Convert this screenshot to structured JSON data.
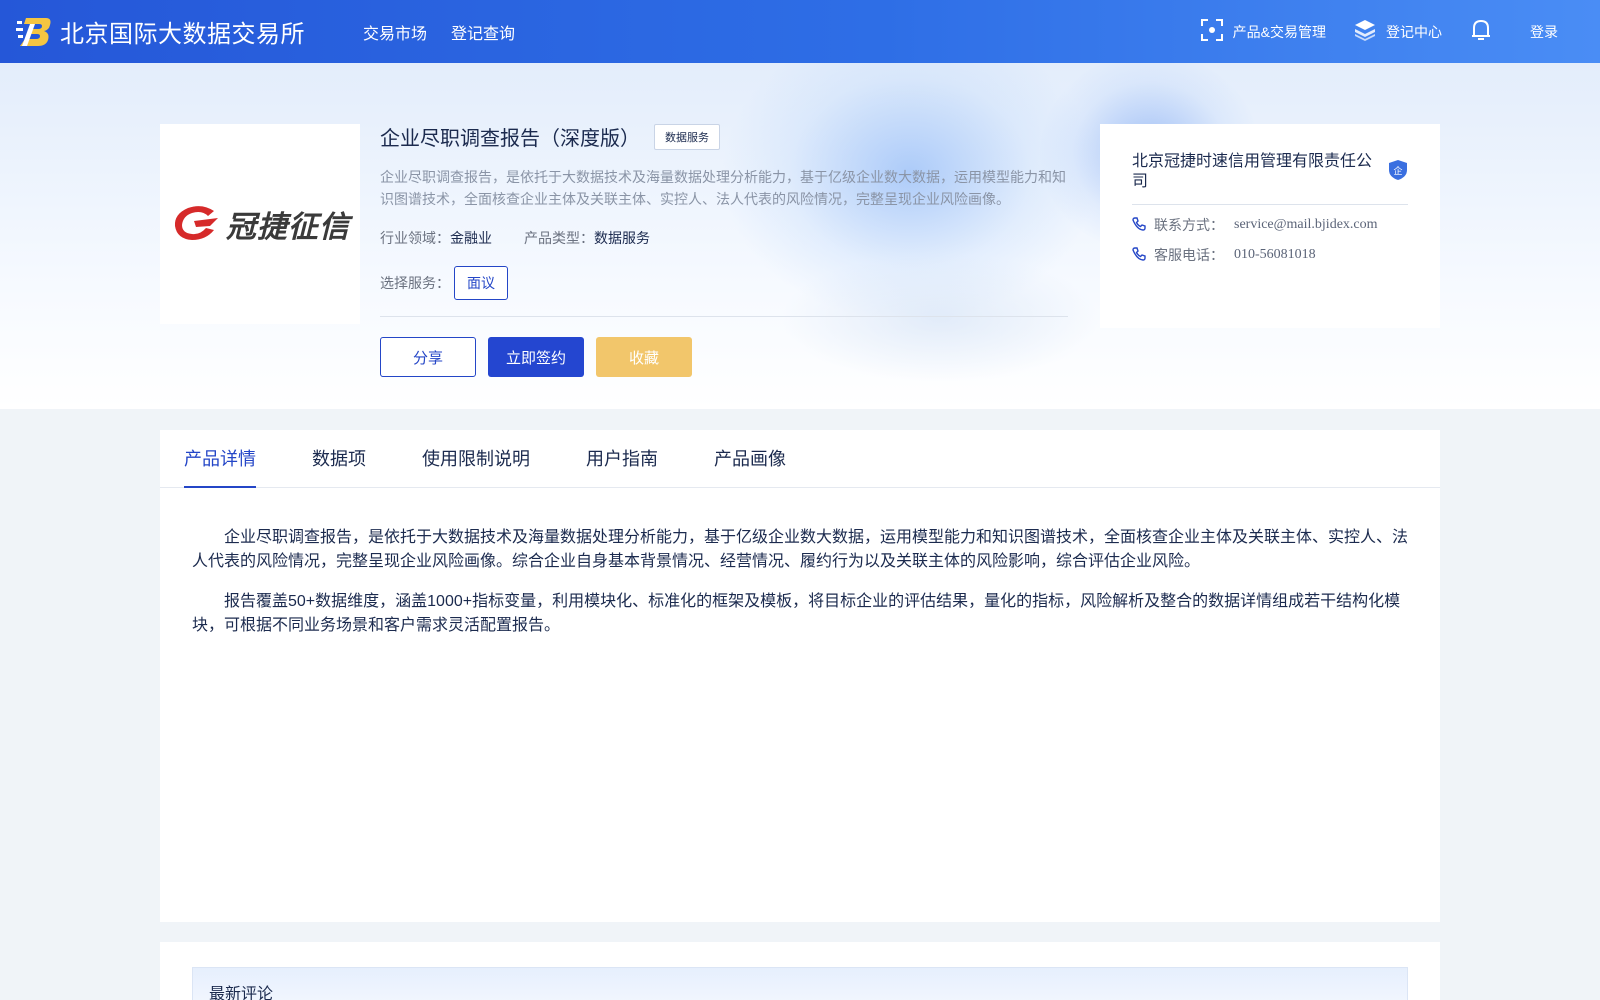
{
  "header": {
    "title": "北京国际大数据交易所",
    "nav": [
      "交易市场",
      "登记查询"
    ],
    "right": {
      "product_mgmt": "产品&交易管理",
      "register_center": "登记中心",
      "login": "登录"
    }
  },
  "product": {
    "logo_text": "冠捷征信",
    "title": "企业尽职调查报告（深度版）",
    "tag": "数据服务",
    "description": "企业尽职调查报告，是依托于大数据技术及海量数据处理分析能力，基于亿级企业数大数据，运用模型能力和知识图谱技术，全面核查企业主体及关联主体、实控人、法人代表的风险情况，完整呈现企业风险画像。",
    "industry_label": "行业领域：",
    "industry": "金融业",
    "type_label": "产品类型：",
    "type": "数据服务",
    "service_label": "选择服务：",
    "service_option": "面议",
    "actions": {
      "share": "分享",
      "sign": "立即签约",
      "favorite": "收藏"
    }
  },
  "company": {
    "name": "北京冠捷时速信用管理有限责任公司",
    "badge": "企",
    "contact_label": "联系方式：",
    "contact": "service@mail.bjidex.com",
    "phone_label": "客服电话：",
    "phone": "010-56081018"
  },
  "tabs": [
    "产品详情",
    "数据项",
    "使用限制说明",
    "用户指南",
    "产品画像"
  ],
  "active_tab": 0,
  "detail": {
    "paragraphs": [
      "企业尽职调查报告，是依托于大数据技术及海量数据处理分析能力，基于亿级企业数大数据，运用模型能力和知识图谱技术，全面核查企业主体及关联主体、实控人、法人代表的风险情况，完整呈现企业风险画像。综合企业自身基本背景情况、经营情况、履约行为以及关联主体的风险影响，综合评估企业风险。",
      "报告覆盖50+数据维度，涵盖1000+指标变量，利用模块化、标准化的框架及模板，将目标企业的评估结果，量化的指标，风险解析及整合的数据详情组成若干结构化模块，可根据不同业务场景和客户需求灵活配置报告。"
    ]
  },
  "comments": {
    "title": "最新评论"
  },
  "colors": {
    "primary": "#2446c7",
    "header_start": "#2557d8",
    "header_end": "#4a8df5",
    "favorite": "#f2c66b"
  }
}
